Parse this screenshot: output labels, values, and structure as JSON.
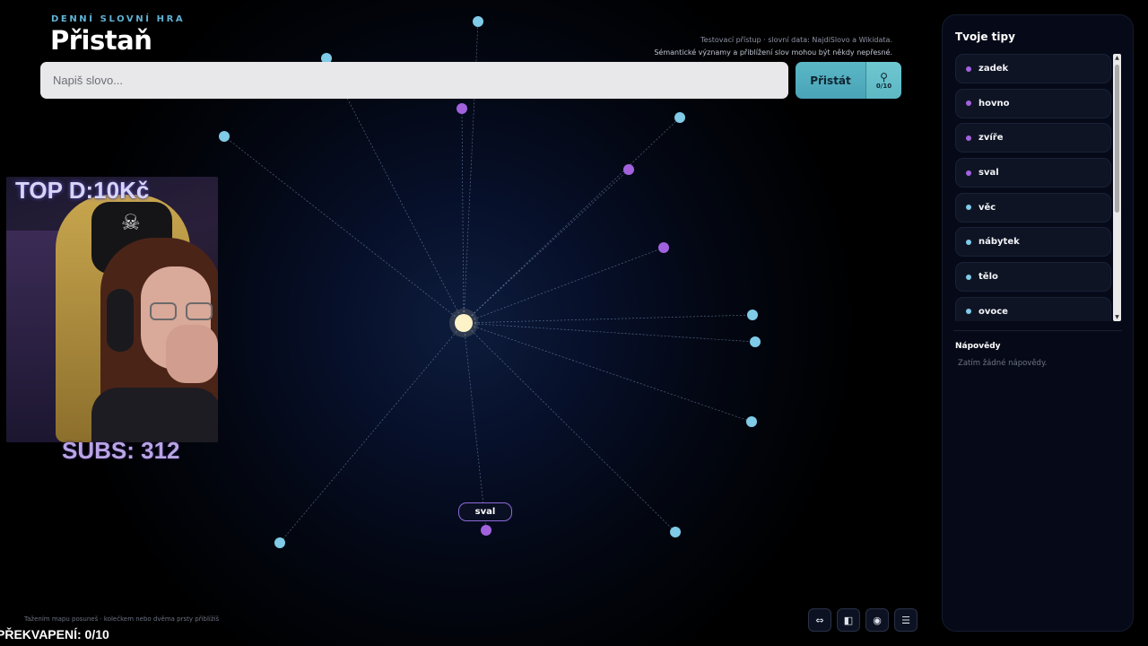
{
  "header": {
    "subtitle": "DENNÍ SLOVNÍ HRA",
    "title": "Přistaň",
    "notice_line1": "Testovací přístup · slovní data: NajdiSlovo a Wikidata.",
    "notice_line2": "Sémantické významy a přiblížení slov mohou být někdy nepřesné."
  },
  "search": {
    "placeholder": "Napiš slovo...",
    "value": ""
  },
  "land_button": {
    "label": "Přistát",
    "icon": "pin-icon"
  },
  "hint_button": {
    "counter": "0/10",
    "icon": "lightbulb-icon"
  },
  "map": {
    "selected_label": "sval",
    "hint_text": "Tažením mapu posuneš · kolečkem nebo dvěma prsty přiblížíš",
    "nodes": [
      {
        "color": "cyan"
      },
      {
        "color": "cyan"
      },
      {
        "color": "cyan"
      },
      {
        "color": "cyan"
      },
      {
        "color": "cyan"
      },
      {
        "color": "cyan"
      },
      {
        "color": "cyan"
      },
      {
        "color": "cyan"
      },
      {
        "color": "cyan"
      },
      {
        "color": "purple"
      },
      {
        "color": "purple"
      },
      {
        "color": "purple"
      },
      {
        "color": "purple"
      }
    ],
    "colors": {
      "cyan": "#7fcbe8",
      "purple": "#a262de",
      "center": "#fdf3c8"
    }
  },
  "overlay": {
    "top_text": "TOP D:10Kč",
    "subs_text": "SUBS: 312",
    "surprise_text": "PŘEKVAPENÍ: 0/10"
  },
  "toolbar": {
    "buttons": [
      {
        "icon": "arrows-horizontal-icon"
      },
      {
        "icon": "sidebar-layout-icon"
      },
      {
        "icon": "eye-icon"
      },
      {
        "icon": "chat-icon"
      }
    ]
  },
  "panel": {
    "title": "Tvoje tipy",
    "guesses": [
      {
        "word": "zadek",
        "color": "#a262de"
      },
      {
        "word": "hovno",
        "color": "#a262de"
      },
      {
        "word": "zvíře",
        "color": "#a262de"
      },
      {
        "word": "sval",
        "color": "#a262de"
      },
      {
        "word": "věc",
        "color": "#7fcbe8"
      },
      {
        "word": "nábytek",
        "color": "#7fcbe8"
      },
      {
        "word": "tělo",
        "color": "#7fcbe8"
      },
      {
        "word": "ovoce",
        "color": "#7fcbe8"
      }
    ],
    "hints_title": "Nápovědy",
    "hints_empty": "Zatím žádné nápovědy."
  }
}
